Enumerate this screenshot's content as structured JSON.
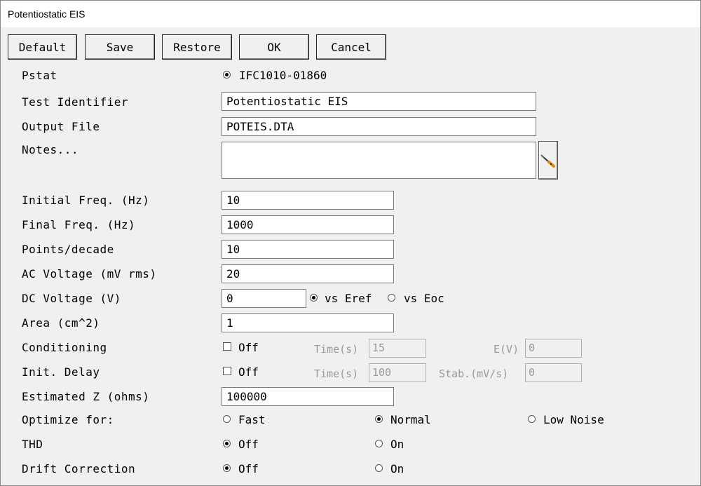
{
  "window": {
    "title": "Potentiostatic EIS"
  },
  "toolbar": {
    "default": "Default",
    "save": "Save",
    "restore": "Restore",
    "ok": "OK",
    "cancel": "Cancel"
  },
  "pstat": {
    "label": "Pstat",
    "option": "IFC1010-01860"
  },
  "test_identifier": {
    "label": "Test Identifier",
    "value": "Potentiostatic EIS"
  },
  "output_file": {
    "label": "Output File",
    "value": "POTEIS.DTA"
  },
  "notes": {
    "label": "Notes...",
    "value": ""
  },
  "initial_freq": {
    "label": "Initial Freq. (Hz)",
    "value": "10"
  },
  "final_freq": {
    "label": "Final Freq. (Hz)",
    "value": "1000"
  },
  "points_decade": {
    "label": "Points/decade",
    "value": "10"
  },
  "ac_voltage": {
    "label": "AC Voltage (mV rms)",
    "value": "20"
  },
  "dc_voltage": {
    "label": "DC Voltage (V)",
    "value": "0",
    "opt_eref": "vs Eref",
    "opt_eoc": "vs Eoc"
  },
  "area": {
    "label": "Area (cm^2)",
    "value": "1"
  },
  "conditioning": {
    "label": "Conditioning",
    "check_label": "Off",
    "time_label": "Time(s)",
    "time_value": "15",
    "e_label": "E(V)",
    "e_value": "0"
  },
  "init_delay": {
    "label": "Init. Delay",
    "check_label": "Off",
    "time_label": "Time(s)",
    "time_value": "100",
    "stab_label": "Stab.(mV/s)",
    "stab_value": "0"
  },
  "estimated_z": {
    "label": "Estimated Z (ohms)",
    "value": "100000"
  },
  "optimize": {
    "label": "Optimize for:",
    "fast": "Fast",
    "normal": "Normal",
    "low_noise": "Low Noise"
  },
  "thd": {
    "label": "THD",
    "off": "Off",
    "on": "On"
  },
  "drift": {
    "label": "Drift Correction",
    "off": "Off",
    "on": "On"
  }
}
